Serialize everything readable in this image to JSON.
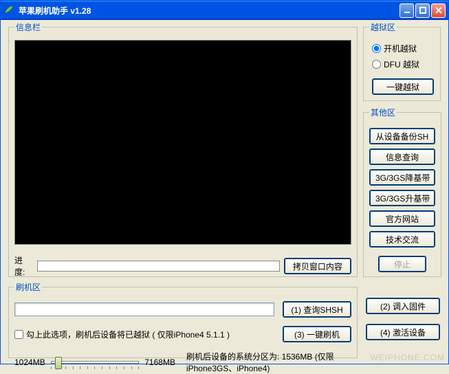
{
  "window": {
    "title": "苹果刷机助手  v1.28"
  },
  "panels": {
    "info_legend": "信息栏",
    "jb_legend": "越狱区",
    "other_legend": "其他区",
    "flash_legend": "刷机区"
  },
  "info": {
    "progress_label": "进度:",
    "copy_button": "拷贝窗口内容"
  },
  "jb": {
    "opt_boot": "开机越狱",
    "opt_dfu": "DFU 越狱",
    "selected": "boot",
    "one_click": "一键越狱"
  },
  "other": {
    "backup_shsh": "从设备备份SH",
    "info_query": "信息查询",
    "downgrade_bb": "3G/3GS降基带",
    "upgrade_bb": "3G/3GS升基带",
    "official_site": "官方网站",
    "tech_support": "技术交流",
    "stop": "停止"
  },
  "flash": {
    "path_value": "",
    "query_shsh": "(1) 查询SHSH",
    "load_fw": "(2) 调入固件",
    "checkbox_label": "勾上此选项，刷机后设备将已越狱 ( 仅限iPhone4 5.1.1 )",
    "one_click_flash": "(3) 一键刷机",
    "activate": "(4) 激活设备",
    "slider_min": "1024MB",
    "slider_max": "7168MB",
    "partition_prefix": "刷机后设备的系统分区为:",
    "partition_value": "1536MB",
    "partition_note": "(仅限iPhone3GS、iPhone4)"
  },
  "watermark": "WEIPHONE.COM"
}
